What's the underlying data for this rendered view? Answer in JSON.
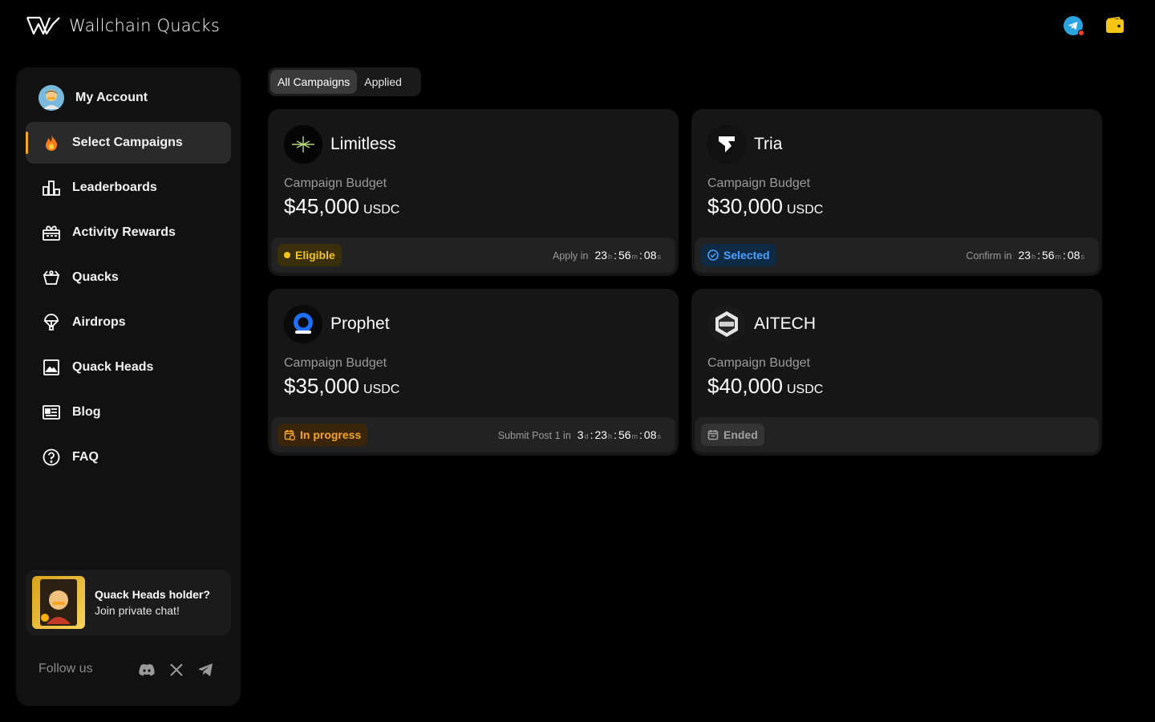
{
  "app": {
    "title": "Wallchain Quacks"
  },
  "header": {
    "telegram_icon": "telegram-icon",
    "wallet_icon": "wallet-icon",
    "accent": "#f5c518"
  },
  "sidebar": {
    "account_label": "My Account",
    "items": [
      {
        "label": "Select Campaigns",
        "icon": "fire-icon",
        "active": true
      },
      {
        "label": "Leaderboards",
        "icon": "podium-icon"
      },
      {
        "label": "Activity Rewards",
        "icon": "gift-icon"
      },
      {
        "label": "Quacks",
        "icon": "basket-icon"
      },
      {
        "label": "Airdrops",
        "icon": "parachute-icon"
      },
      {
        "label": "Quack Heads",
        "icon": "image-icon"
      },
      {
        "label": "Blog",
        "icon": "newspaper-icon"
      },
      {
        "label": "FAQ",
        "icon": "question-icon"
      }
    ],
    "promo": {
      "title": "Quack Heads holder?",
      "subtitle": "Join private chat!"
    },
    "follow_label": "Follow us"
  },
  "tabs": [
    {
      "label": "All Campaigns",
      "active": true
    },
    {
      "label": "Applied",
      "active": false
    }
  ],
  "campaigns": [
    {
      "name": "Limitless",
      "budget_label": "Campaign Budget",
      "budget": "$45,000",
      "unit": "USDC",
      "status": "Eligible",
      "timer_label": "Apply in",
      "timer": {
        "d": null,
        "h": "23",
        "m": "56",
        "s": "08"
      }
    },
    {
      "name": "Tria",
      "budget_label": "Campaign Budget",
      "budget": "$30,000",
      "unit": "USDC",
      "status": "Selected",
      "timer_label": "Confirm in",
      "timer": {
        "d": null,
        "h": "23",
        "m": "56",
        "s": "08"
      }
    },
    {
      "name": "Prophet",
      "budget_label": "Campaign Budget",
      "budget": "$35,000",
      "unit": "USDC",
      "status": "In progress",
      "timer_label": "Submit Post 1 in",
      "timer": {
        "d": "3",
        "h": "23",
        "m": "56",
        "s": "08"
      }
    },
    {
      "name": "AITECH",
      "budget_label": "Campaign Budget",
      "budget": "$40,000",
      "unit": "USDC",
      "status": "Ended",
      "timer_label": "",
      "timer": null
    }
  ],
  "units": {
    "d": "d",
    "h": "h",
    "m": "m",
    "s": "s"
  }
}
